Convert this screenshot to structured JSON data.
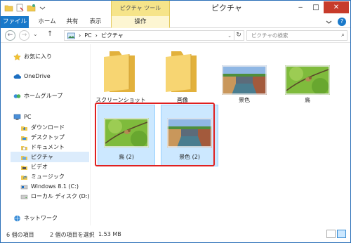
{
  "window": {
    "title": "ピクチャ"
  },
  "ribbon": {
    "tool_group": "ピクチャ ツール",
    "tabs": [
      "ファイル",
      "ホーム",
      "共有",
      "表示",
      "操作"
    ]
  },
  "navbar": {
    "back": "←",
    "forward": "→",
    "dropdown": "⌄",
    "up": "↑",
    "path": [
      "PC",
      "ピクチャ"
    ],
    "search_placeholder": "ピクチャの検索"
  },
  "sidebar": {
    "items": [
      "お気に入り",
      "OneDrive",
      "ホームグループ",
      "PC",
      "ダウンロード",
      "デスクトップ",
      "ドキュメント",
      "ピクチャ",
      "ビデオ",
      "ミュージック",
      "Windows 8.1 (C:)",
      "ローカル ディスク (D:)",
      "ネットワーク"
    ]
  },
  "files": [
    {
      "name": "スクリーンショット",
      "type": "folder"
    },
    {
      "name": "画像",
      "type": "folder"
    },
    {
      "name": "景色",
      "type": "image-canal"
    },
    {
      "name": "鳥",
      "type": "image-bird"
    },
    {
      "name": "鳥 (2)",
      "type": "image-bird",
      "selected": true
    },
    {
      "name": "景色 (2)",
      "type": "image-canal",
      "selected": true
    }
  ],
  "status": {
    "count": "6 個の項目",
    "selection": "2 個の項目を選択",
    "size": "1.53 MB"
  },
  "colors": {
    "accent": "#1979ca",
    "selection": "#cce8ff",
    "highlight_frame": "#e02020",
    "tool_tab": "#f6e48a"
  }
}
